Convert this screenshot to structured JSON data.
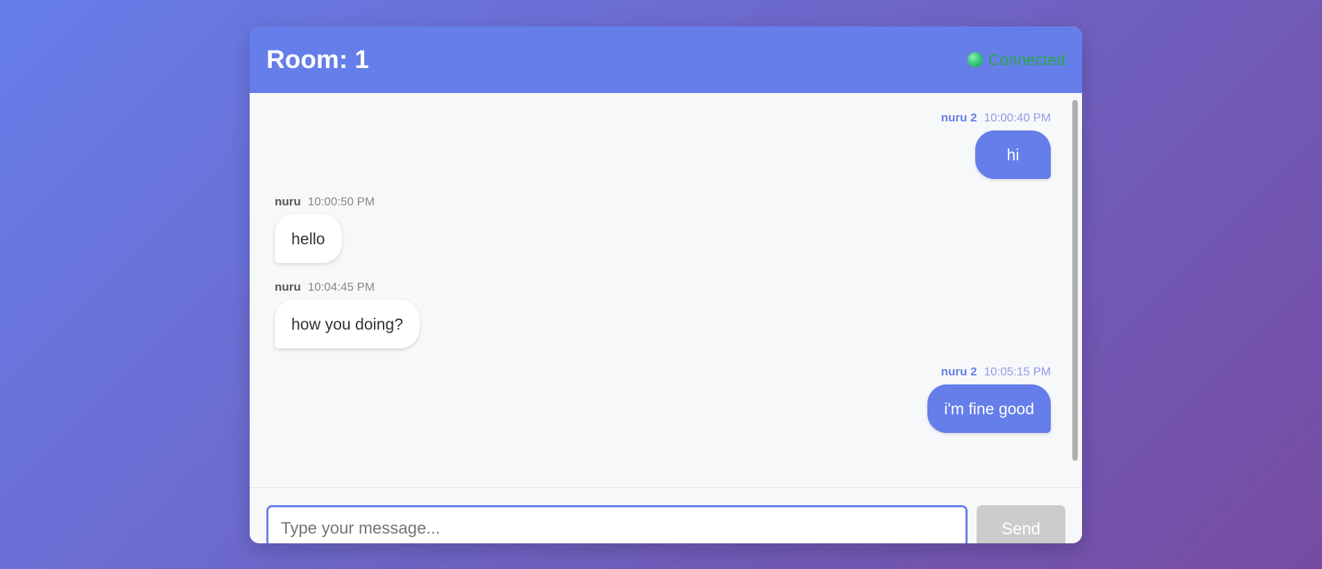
{
  "header": {
    "room_title": "Room: 1",
    "status_label": "Connected"
  },
  "messages": [
    {
      "sender": "nuru 2",
      "time": "10:00:40 PM",
      "text": "hi",
      "direction": "sent"
    },
    {
      "sender": "nuru",
      "time": "10:00:50 PM",
      "text": "hello",
      "direction": "received"
    },
    {
      "sender": "nuru",
      "time": "10:04:45 PM",
      "text": "how you doing?",
      "direction": "received"
    },
    {
      "sender": "nuru 2",
      "time": "10:05:15 PM",
      "text": "i'm fine good",
      "direction": "sent"
    }
  ],
  "composer": {
    "placeholder": "Type your message...",
    "send_label": "Send"
  },
  "colors": {
    "accent": "#667eea",
    "connected": "#28a745",
    "send_disabled": "#cccccc"
  }
}
